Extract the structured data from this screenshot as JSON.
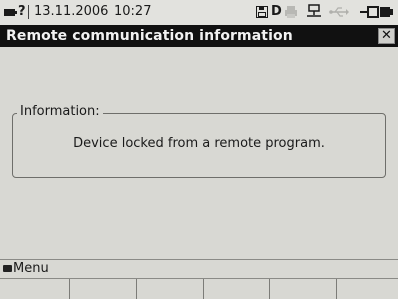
{
  "status_bar": {
    "question_mark": "?",
    "date": "13.11.2006",
    "time": "10:27",
    "d_indicator": "D"
  },
  "window": {
    "title": "Remote communication information",
    "close_glyph": "✕"
  },
  "info_group": {
    "title": "Information:",
    "message": "Device locked from a remote program."
  },
  "menu_bar": {
    "label": "Menu"
  },
  "softkeys": [
    "",
    "",
    "",
    "",
    "",
    ""
  ],
  "icons": {
    "battery": "battery-icon",
    "disk": "disk-icon",
    "printer": "printer-icon",
    "network": "network-icon",
    "usb": "usb-icon",
    "plug": "plug-icon"
  }
}
